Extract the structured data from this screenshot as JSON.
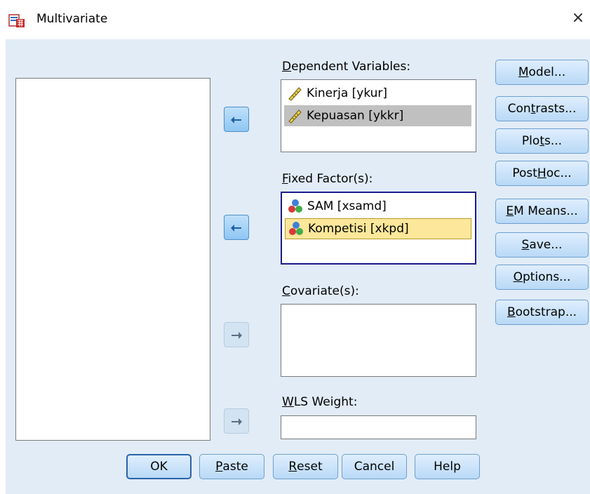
{
  "window": {
    "title": "Multivariate",
    "close_glyph": "×"
  },
  "dependent": {
    "label_mn": "D",
    "label_rest": "ependent Variables:",
    "items": [
      {
        "label": "Kinerja [ykur]",
        "icon": "ruler-scale-icon",
        "selected": false
      },
      {
        "label": "Kepuasan [ykkr]",
        "icon": "ruler-scale-icon",
        "selected": true
      }
    ]
  },
  "fixed": {
    "label_mn": "F",
    "label_rest": "ixed Factor(s):",
    "items": [
      {
        "label": "SAM [xsamd]",
        "icon": "nominal-balls-icon",
        "selected": false
      },
      {
        "label": "Kompetisi [xkpd]",
        "icon": "nominal-balls-icon",
        "selected": true
      }
    ]
  },
  "covariates": {
    "label_mn": "C",
    "label_rest": "ovariate(s):"
  },
  "wls": {
    "label_mn": "W",
    "label_rest": "LS Weight:",
    "value": ""
  },
  "side_buttons": {
    "model": {
      "pre": "",
      "mn": "M",
      "post": "odel..."
    },
    "contrasts": {
      "pre": "Con",
      "mn": "t",
      "post": "rasts..."
    },
    "plots": {
      "pre": "Plo",
      "mn": "t",
      "post": "s..."
    },
    "posthoc": {
      "pre": "Post ",
      "mn": "H",
      "post": "oc..."
    },
    "emmeans": {
      "pre": "",
      "mn": "E",
      "post": "M Means..."
    },
    "save": {
      "pre": "",
      "mn": "S",
      "post": "ave..."
    },
    "options": {
      "pre": "",
      "mn": "O",
      "post": "ptions..."
    },
    "bootstrap": {
      "pre": "",
      "mn": "B",
      "post": "ootstrap..."
    }
  },
  "bottom_buttons": {
    "ok": {
      "pre": "OK",
      "mn": "",
      "post": ""
    },
    "paste": {
      "pre": "",
      "mn": "P",
      "post": "aste"
    },
    "reset": {
      "pre": "",
      "mn": "R",
      "post": "eset"
    },
    "cancel": {
      "pre": "Cancel",
      "mn": "",
      "post": ""
    },
    "help": {
      "pre": "Help",
      "mn": "",
      "post": ""
    }
  },
  "colors": {
    "client_bg": "#e1ecf7",
    "selected_gray": "#c0c0c0",
    "selected_yellow": "#fce79a",
    "focus_border": "#1a1a8c"
  }
}
